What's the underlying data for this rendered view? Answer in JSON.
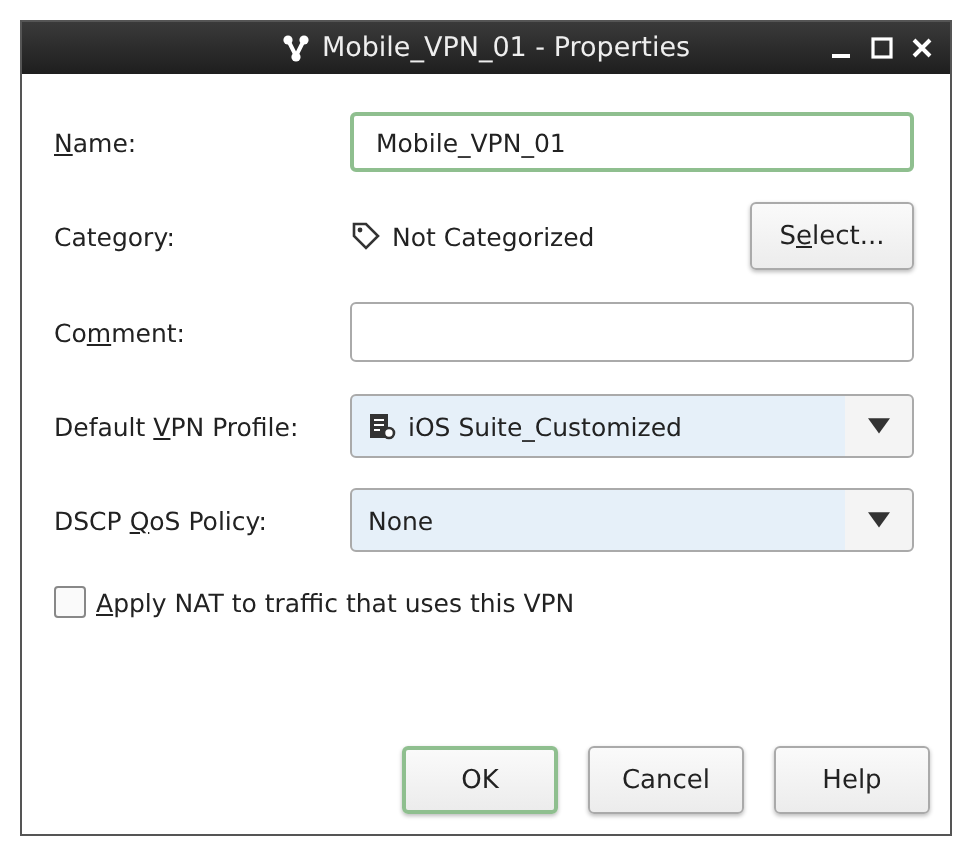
{
  "window": {
    "title": "Mobile_VPN_01 - Properties"
  },
  "fields": [
    {
      "kind": "text",
      "label": {
        "key": "N",
        "post": "ame:"
      },
      "value": "Mobile_VPN_01",
      "focused": true
    },
    {
      "kind": "category",
      "label": {
        "pre": "Category:"
      },
      "value": "Not Categorized",
      "button": {
        "pre": "S",
        "key": "e",
        "post": "lect..."
      }
    },
    {
      "kind": "text",
      "label": {
        "pre": "Co",
        "key": "m",
        "post": "ment:"
      },
      "focused": false
    },
    {
      "kind": "combo",
      "label": {
        "pre": "Default ",
        "key": "V",
        "post": "PN Profile:"
      },
      "value": "iOS Suite_Customized",
      "icon": true
    },
    {
      "kind": "combo",
      "label": {
        "pre": "DSCP ",
        "key": "Q",
        "post": "oS Policy:"
      },
      "value": "None",
      "icon": false
    }
  ],
  "checkbox": {
    "label": {
      "key": "A",
      "post": "pply NAT to traffic that uses this VPN"
    },
    "checked": false
  },
  "buttons": [
    {
      "label": "OK",
      "default": true
    },
    {
      "label": "Cancel",
      "default": false
    },
    {
      "label": "Help",
      "default": false
    }
  ]
}
